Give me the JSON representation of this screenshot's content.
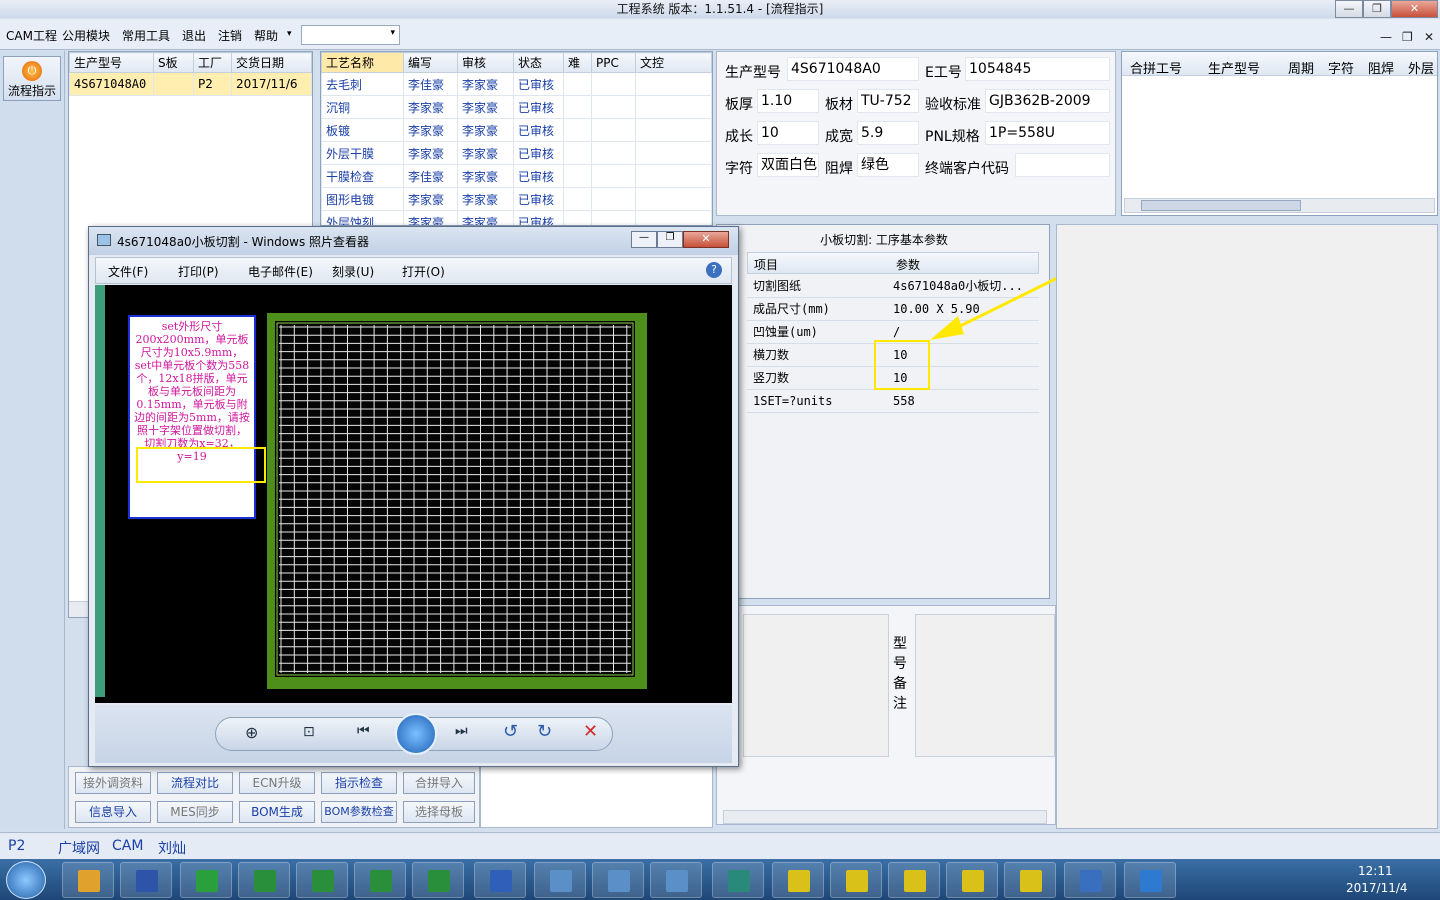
{
  "window": {
    "title": "工程系统   版本：1.1.51.4 - [流程指示]",
    "minimize": "—",
    "maximize": "❐",
    "close": "✕"
  },
  "menu": {
    "items": [
      "CAM工程",
      "公用模块",
      "常用工具",
      "退出",
      "注销",
      "帮助"
    ],
    "help_arrow": "▾",
    "combo_arrow": "▾"
  },
  "mdi": {
    "min": "—",
    "restore": "❐",
    "close": "✕"
  },
  "nav": {
    "flow_label": "流程指示"
  },
  "orders": {
    "headers": [
      "生产型号",
      "S板",
      "工厂",
      "交货日期"
    ],
    "rows": [
      [
        "4S671048A0",
        "",
        "P2",
        "2017/11/6"
      ]
    ]
  },
  "process": {
    "headers": [
      "工艺名称",
      "编写",
      "审核",
      "状态",
      "难",
      "PPC",
      "文控"
    ],
    "rows": [
      [
        "去毛刺",
        "李佳豪",
        "李家豪",
        "已审核"
      ],
      [
        "沉铜",
        "李家豪",
        "李家豪",
        "已审核"
      ],
      [
        "板镀",
        "李家豪",
        "李家豪",
        "已审核"
      ],
      [
        "外层干膜",
        "李家豪",
        "李家豪",
        "已审核"
      ],
      [
        "干膜检查",
        "李佳豪",
        "李家豪",
        "已审核"
      ],
      [
        "图形电镀",
        "李家豪",
        "李家豪",
        "已审核"
      ],
      [
        "外层蚀刻",
        "李家豪",
        "李家豪",
        "已审核"
      ]
    ]
  },
  "info": {
    "model_label": "生产型号",
    "model": "4S671048A0",
    "eno_label": "E工号",
    "eno": "1054845",
    "thick_label": "板厚",
    "thick": "1.10",
    "mat_label": "板材",
    "mat": "TU-752",
    "std_label": "验收标准",
    "std": "GJB362B-2009",
    "len_label": "成长",
    "len": "10",
    "wid_label": "成宽",
    "wid": "5.9",
    "pnl_label": "PNL规格",
    "pnl": "1P=558U",
    "char_label": "字符",
    "char": "双面白色",
    "mask_label": "阻焊",
    "mask": "绿色",
    "cust_label": "终端客户代码",
    "cust": ""
  },
  "combine": {
    "headers": [
      "合拼工号",
      "生产型号",
      "周期",
      "字符",
      "阻焊",
      "外层"
    ]
  },
  "param": {
    "title": "小板切割: 工序基本参数",
    "col_item": "项目",
    "col_val": "参数",
    "rows": [
      [
        "切割图纸",
        "4s671048a0小板切..."
      ],
      [
        "成品尺寸(mm)",
        "10.00 X 5.90"
      ],
      [
        "凹蚀量(um)",
        "/"
      ],
      [
        "横刀数",
        "10"
      ],
      [
        "竖刀数",
        "10"
      ],
      [
        "1SET=?units",
        "558"
      ]
    ]
  },
  "note": {
    "side_label": "型号备注"
  },
  "buttons": {
    "row1": [
      "接外调资料",
      "流程对比",
      "ECN升级",
      "指示检查",
      "合拼导入"
    ],
    "row2": [
      "信息导入",
      "MES同步",
      "BOM生成",
      "BOM参数检查",
      "选择母板"
    ]
  },
  "status": {
    "factory": "P2",
    "net": "广域网",
    "dept": "CAM",
    "user": "刘灿"
  },
  "viewer": {
    "title": "4s671048a0小板切割 - Windows 照片查看器",
    "menu": [
      "文件(F)",
      "打印(P)",
      "电子邮件(E)",
      "刻录(U)",
      "打开(O)"
    ],
    "note_text": "set外形尺寸200x200mm，单元板尺寸为10x5.9mm，set中单元板个数为558个，12x18拼版，单元板与单元板间距为0.15mm，单元板与附边的间距为5mm，请按照十字架位置做切割，",
    "note_highlight": "切割刀数为x=32，y=19"
  },
  "tray": {
    "time": "12:11",
    "date": "2017/11/4"
  },
  "colors": {
    "accent": "#1a3fa6",
    "highlight": "#ffe900",
    "board": "#4d8f1a"
  }
}
